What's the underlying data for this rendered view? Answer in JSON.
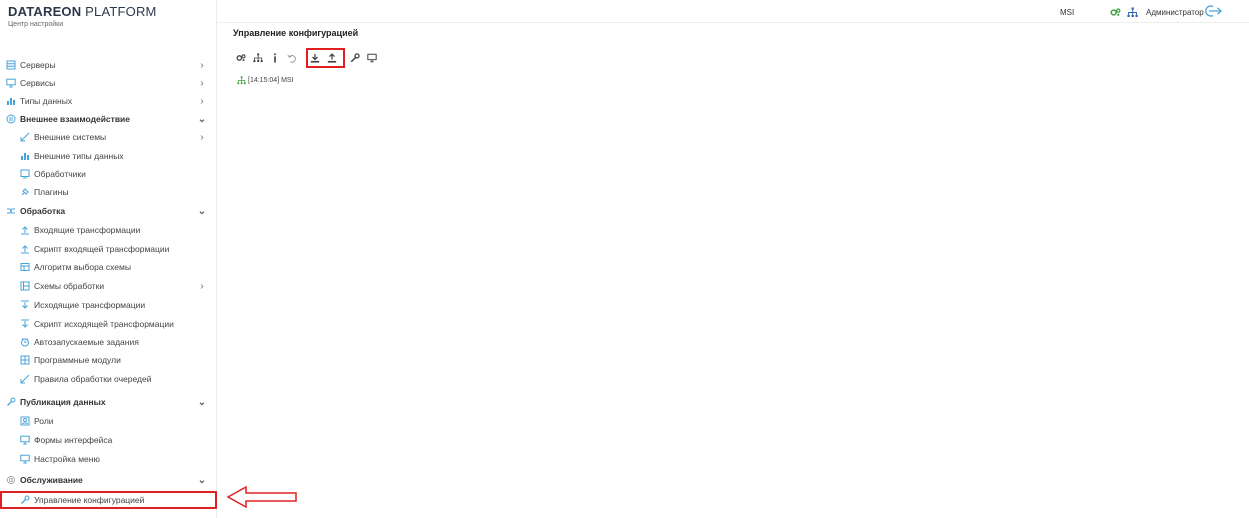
{
  "brand": {
    "name_bold": "DATAREON",
    "name_light": " PLATFORM",
    "subtitle": "Центр настройки"
  },
  "topbar": {
    "host": "MSI",
    "user": "Администратор"
  },
  "sidebar": {
    "items": [
      {
        "label": "Серверы",
        "icon": "database-icon",
        "kind": "top",
        "arrow": "›"
      },
      {
        "label": "Сервисы",
        "icon": "monitor-icon",
        "kind": "top",
        "arrow": "›"
      },
      {
        "label": "Типы данных",
        "icon": "chart-icon",
        "kind": "top",
        "arrow": "›"
      },
      {
        "label": "Внешнее взаимодействие",
        "icon": "exchange-icon",
        "kind": "section",
        "arrow": "⌄"
      },
      {
        "label": "Внешние системы",
        "icon": "systems-icon",
        "kind": "sub",
        "arrow": "›"
      },
      {
        "label": "Внешние типы данных",
        "icon": "ext-types-icon",
        "kind": "sub",
        "arrow": ""
      },
      {
        "label": "Обработчики",
        "icon": "handlers-icon",
        "kind": "sub",
        "arrow": ""
      },
      {
        "label": "Плагины",
        "icon": "plugin-icon",
        "kind": "sub",
        "arrow": ""
      },
      {
        "label": "Обработка",
        "icon": "processing-icon",
        "kind": "section",
        "arrow": "⌄"
      },
      {
        "label": "Входящие трансформации",
        "icon": "incoming-icon",
        "kind": "sub",
        "arrow": ""
      },
      {
        "label": "Скрипт входящей трансформации",
        "icon": "incoming-script-icon",
        "kind": "sub",
        "arrow": ""
      },
      {
        "label": "Алгоритм выбора схемы",
        "icon": "algorithm-icon",
        "kind": "sub",
        "arrow": ""
      },
      {
        "label": "Схемы обработки",
        "icon": "schemes-icon",
        "kind": "sub",
        "arrow": "›"
      },
      {
        "label": "Исходящие трансформации",
        "icon": "outgoing-icon",
        "kind": "sub",
        "arrow": ""
      },
      {
        "label": "Скрипт исходящей трансформации",
        "icon": "outgoing-script-icon",
        "kind": "sub",
        "arrow": ""
      },
      {
        "label": "Автозапускаемые задания",
        "icon": "clock-icon",
        "kind": "sub",
        "arrow": ""
      },
      {
        "label": "Программные модули",
        "icon": "modules-icon",
        "kind": "sub",
        "arrow": ""
      },
      {
        "label": "Правила обработки очередей",
        "icon": "queue-rules-icon",
        "kind": "sub",
        "arrow": ""
      },
      {
        "label": "Публикация данных",
        "icon": "publish-icon",
        "kind": "section",
        "arrow": "⌄"
      },
      {
        "label": "Роли",
        "icon": "roles-icon",
        "kind": "sub",
        "arrow": ""
      },
      {
        "label": "Формы интерфейса",
        "icon": "forms-icon",
        "kind": "sub",
        "arrow": ""
      },
      {
        "label": "Настройка меню",
        "icon": "menu-settings-icon",
        "kind": "sub",
        "arrow": ""
      },
      {
        "label": "Обслуживание",
        "icon": "service-gear-icon",
        "kind": "section",
        "arrow": "⌄"
      },
      {
        "label": "Управление конфигурацией",
        "icon": "wrench-icon",
        "kind": "sub",
        "arrow": "",
        "active": true
      }
    ]
  },
  "main": {
    "title": "Управление конфигурацией",
    "toolbar": [
      "settings-icon",
      "hierarchy-icon",
      "info-icon",
      "undo-icon",
      "download-icon",
      "upload-icon",
      "wrench-icon",
      "monitor-icon"
    ],
    "log": "[14:15:04] MSI"
  },
  "colors": {
    "accent_green": "#3aa33a",
    "accent_blue": "#2a5db0",
    "icon_blue": "#4aa3d8",
    "highlight_red": "#e02020"
  }
}
